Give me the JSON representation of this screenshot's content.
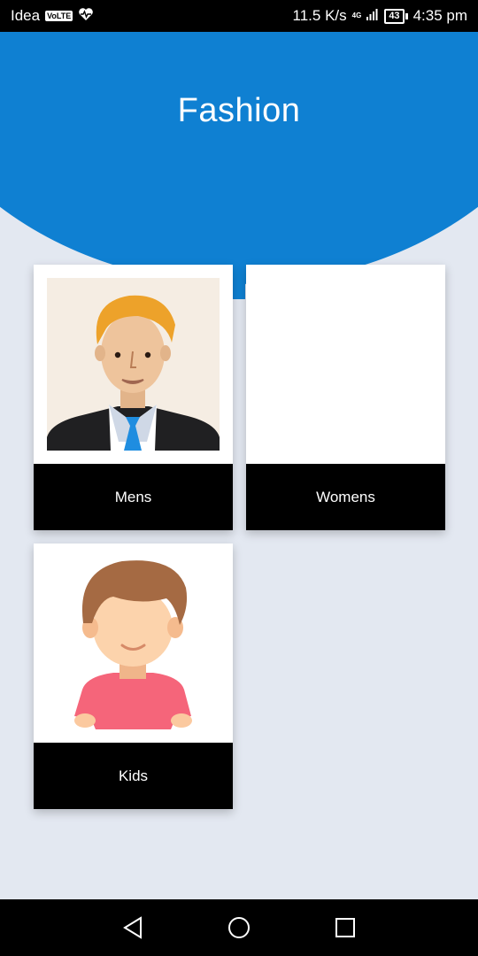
{
  "status_bar": {
    "carrier": "Idea",
    "volte": "VoLTE",
    "network": "4G",
    "speed": "11.5 K/s",
    "battery": "43",
    "time": "4:35 pm"
  },
  "header": {
    "title": "Fashion"
  },
  "categories": [
    {
      "label": "Mens"
    },
    {
      "label": "Womens"
    },
    {
      "label": "Kids"
    }
  ],
  "colors": {
    "header": "#0f80d2",
    "background": "#e3e8f1",
    "label_bar": "#000000"
  },
  "nav": {
    "back_icon": "back-triangle-icon",
    "home_icon": "home-circle-icon",
    "recents_icon": "recents-square-icon"
  }
}
